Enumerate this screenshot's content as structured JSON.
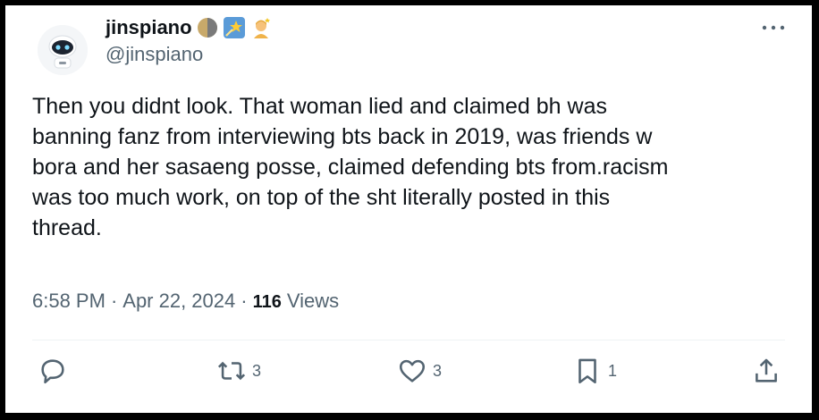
{
  "author": {
    "name": "jinspiano",
    "handle": "@jinspiano",
    "badges": [
      "moon-icon",
      "shooting-star-icon",
      "person-emoji-icon"
    ]
  },
  "tweet": {
    "text": "Then you didnt look. That woman lied and claimed bh was\nbanning fanz from interviewing bts back in 2019, was friends w\nbora and her sasaeng posse, claimed defending bts from.racism\nwas too much work, on top of the sht literally posted in this\nthread.",
    "time": "6:58 PM",
    "date": "Apr 22, 2024",
    "separator": "·",
    "views_count": "116",
    "views_label": "Views"
  },
  "actions": {
    "reply_icon": "reply-icon",
    "retweet_count": "3",
    "like_count": "3",
    "bookmark_count": "1",
    "share_icon": "share-icon"
  },
  "colors": {
    "text": "#0f1419",
    "secondary": "#536471",
    "divider": "#eff3f4"
  }
}
